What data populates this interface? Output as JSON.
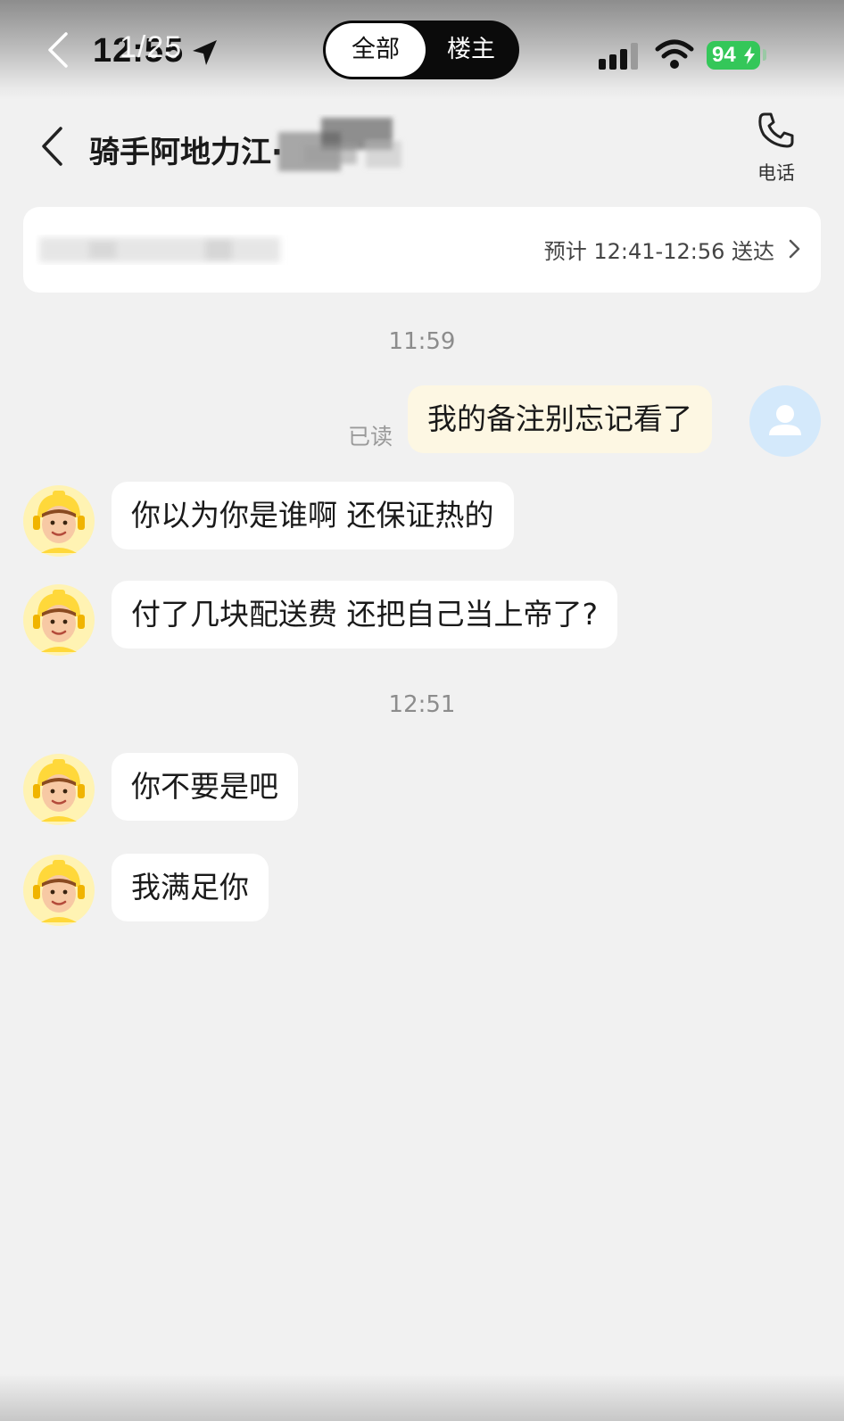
{
  "viewer": {
    "page_counter": "1/25",
    "toggle": {
      "all_label": "全部",
      "op_label": "楼主",
      "selected": "全部"
    }
  },
  "status_bar": {
    "time": "12:55",
    "battery_level": "94"
  },
  "header": {
    "title": "骑手阿地力江·",
    "phone_label": "电话"
  },
  "order_card": {
    "eta": "预计 12:41-12:56 送达"
  },
  "messages": {
    "time1": "11:59",
    "m1": {
      "text": "我的备注别忘记看了",
      "status": "已读"
    },
    "m2": "你以为你是谁啊 还保证热的",
    "m3": "付了几块配送费 还把自己当上帝了?",
    "time2": "12:51",
    "m4": "你不要是吧",
    "m5": "我满足你"
  },
  "colors": {
    "background": "#f1f1f1",
    "outgoing_bubble": "#fdf7e3",
    "incoming_bubble": "#ffffff",
    "my_avatar": "#d4e9fb",
    "rider_avatar_bg": "#fff3b3",
    "battery": "#34c759"
  }
}
